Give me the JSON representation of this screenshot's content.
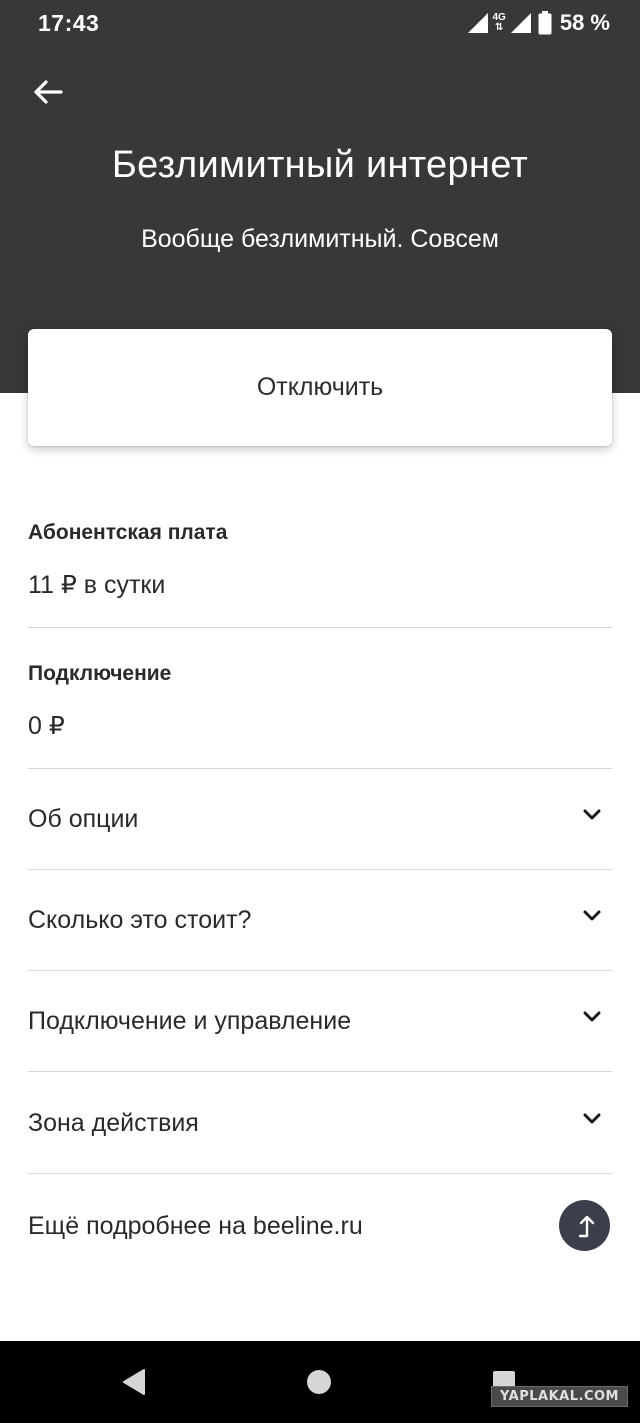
{
  "status_bar": {
    "time": "17:43",
    "network": "4G",
    "battery_percent": "58 %"
  },
  "header": {
    "title": "Безлимитный интернет",
    "subtitle": "Вообще безлимитный. Совсем",
    "back_icon": "arrow-left-icon"
  },
  "action": {
    "disable_label": "Отключить"
  },
  "info": [
    {
      "label": "Абонентская плата",
      "value": "11 ₽ в сутки"
    },
    {
      "label": "Подключение",
      "value": "0 ₽"
    }
  ],
  "accordion": [
    {
      "label": "Об опции"
    },
    {
      "label": "Сколько это стоит?"
    },
    {
      "label": "Подключение и управление"
    },
    {
      "label": "Зона действия"
    }
  ],
  "more": {
    "label": "Ещё подробнее на beeline.ru",
    "icon": "external-link-icon"
  },
  "watermark": "YAPLAKAL.COM",
  "colors": {
    "header_bg": "#383838",
    "accent_circle": "#3a3f4b",
    "divider": "#d8d8d8"
  }
}
